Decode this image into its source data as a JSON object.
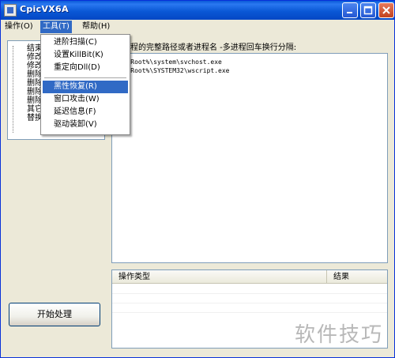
{
  "window": {
    "title": "CpicVX6A"
  },
  "menubar": {
    "items": [
      {
        "label": "操作(O)"
      },
      {
        "label": "工具(T)"
      },
      {
        "label": "帮助(H)"
      }
    ]
  },
  "tools_menu": {
    "items": [
      {
        "label": "进阶扫描(C)"
      },
      {
        "label": "设置KillBit(K)"
      },
      {
        "label": "重定向Dll(D)"
      },
      {
        "label": "黑性恢复(R)"
      },
      {
        "label": "窗口攻击(W)"
      },
      {
        "label": "延迟信息(F)"
      },
      {
        "label": "驱动装卸(V)"
      }
    ],
    "highlighted": "黑性恢复(R)"
  },
  "tree": {
    "items": [
      {
        "label": "结束"
      },
      {
        "label": "修改"
      },
      {
        "label": "修改"
      },
      {
        "label": "删除"
      },
      {
        "label": "删除"
      },
      {
        "label": "删除"
      },
      {
        "label": "删除"
      },
      {
        "label": "其它"
      },
      {
        "label": "替换"
      }
    ]
  },
  "process_input": {
    "label": "束进程的完整路径或者进程名 -多进程回车换行分隔:",
    "lines": [
      "stemRoot%\\system\\svchost.exe",
      "stemRoot%\\SYSTEM32\\wscript.exe"
    ]
  },
  "results_table": {
    "columns": [
      {
        "label": "操作类型"
      },
      {
        "label": "结果"
      }
    ],
    "rows": []
  },
  "start_button": {
    "label": "开始处理"
  },
  "watermark": {
    "text": "软件技巧"
  }
}
